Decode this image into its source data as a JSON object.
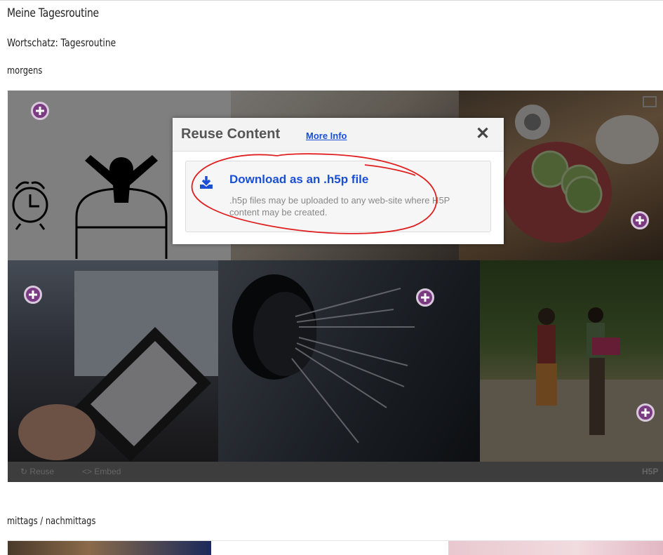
{
  "page": {
    "title": "Meine Tagesroutine",
    "subtitle": "Wortschatz: Tagesroutine",
    "section_morning": "morgens",
    "section_afternoon": "mittags / nachmittags"
  },
  "h5p_bar": {
    "reuse_label": "Reuse",
    "embed_label": "Embed",
    "logo_text": "H5P"
  },
  "modal": {
    "title": "Reuse Content",
    "more_info": "More Info",
    "close": "✕",
    "option_title": "Download as an .h5p file",
    "option_desc": ".h5p files may be uploaded to any web-site where H5P content may be created."
  },
  "colors": {
    "link_blue": "#1a4fd6",
    "hotspot_purple": "#7a3b82",
    "annotation_red": "#e02020"
  }
}
